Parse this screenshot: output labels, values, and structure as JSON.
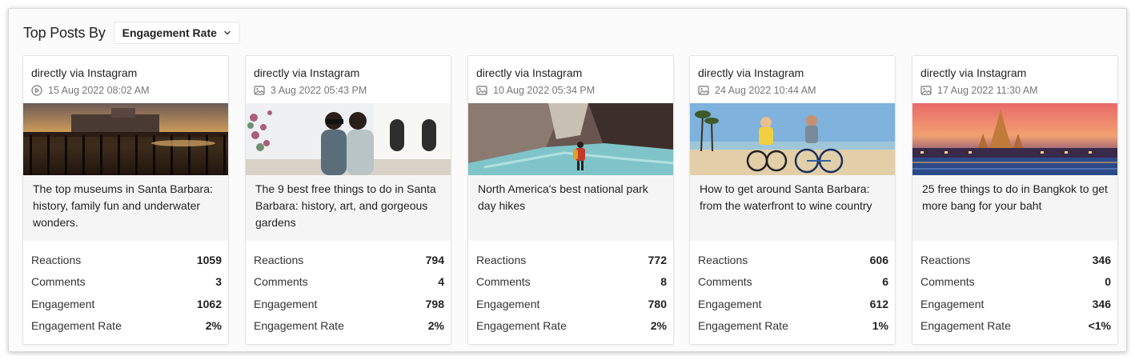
{
  "header": {
    "title": "Top Posts By",
    "metric_selector": "Engagement Rate"
  },
  "stat_labels": {
    "reactions": "Reactions",
    "comments": "Comments",
    "engagement": "Engagement",
    "engagement_rate": "Engagement Rate"
  },
  "posts": [
    {
      "source": "directly via Instagram",
      "date": "15 Aug 2022 08:02 AM",
      "media_icon": "video-icon",
      "caption": "The top museums in Santa Barbara: history, family fun and underwater wonders.",
      "reactions": "1059",
      "comments": "3",
      "engagement": "1062",
      "engagement_rate": "2%"
    },
    {
      "source": "directly via Instagram",
      "date": "3 Aug 2022 05:43 PM",
      "media_icon": "image-icon",
      "caption": "The 9 best free things to do in Santa Barbara: history, art, and gorgeous gardens",
      "reactions": "794",
      "comments": "4",
      "engagement": "798",
      "engagement_rate": "2%"
    },
    {
      "source": "directly via Instagram",
      "date": "10 Aug 2022 05:34 PM",
      "media_icon": "image-icon",
      "caption": "North America's best national park day hikes",
      "reactions": "772",
      "comments": "8",
      "engagement": "780",
      "engagement_rate": "2%"
    },
    {
      "source": "directly via Instagram",
      "date": "24 Aug 2022 10:44 AM",
      "media_icon": "image-icon",
      "caption": "How to get around Santa Barbara: from the waterfront to wine country",
      "reactions": "606",
      "comments": "6",
      "engagement": "612",
      "engagement_rate": "1%"
    },
    {
      "source": "directly via Instagram",
      "date": "17 Aug 2022 11:30 AM",
      "media_icon": "image-icon",
      "caption": "25 free things to do in Bangkok to get more bang for your baht",
      "reactions": "346",
      "comments": "0",
      "engagement": "346",
      "engagement_rate": "<1%"
    }
  ]
}
